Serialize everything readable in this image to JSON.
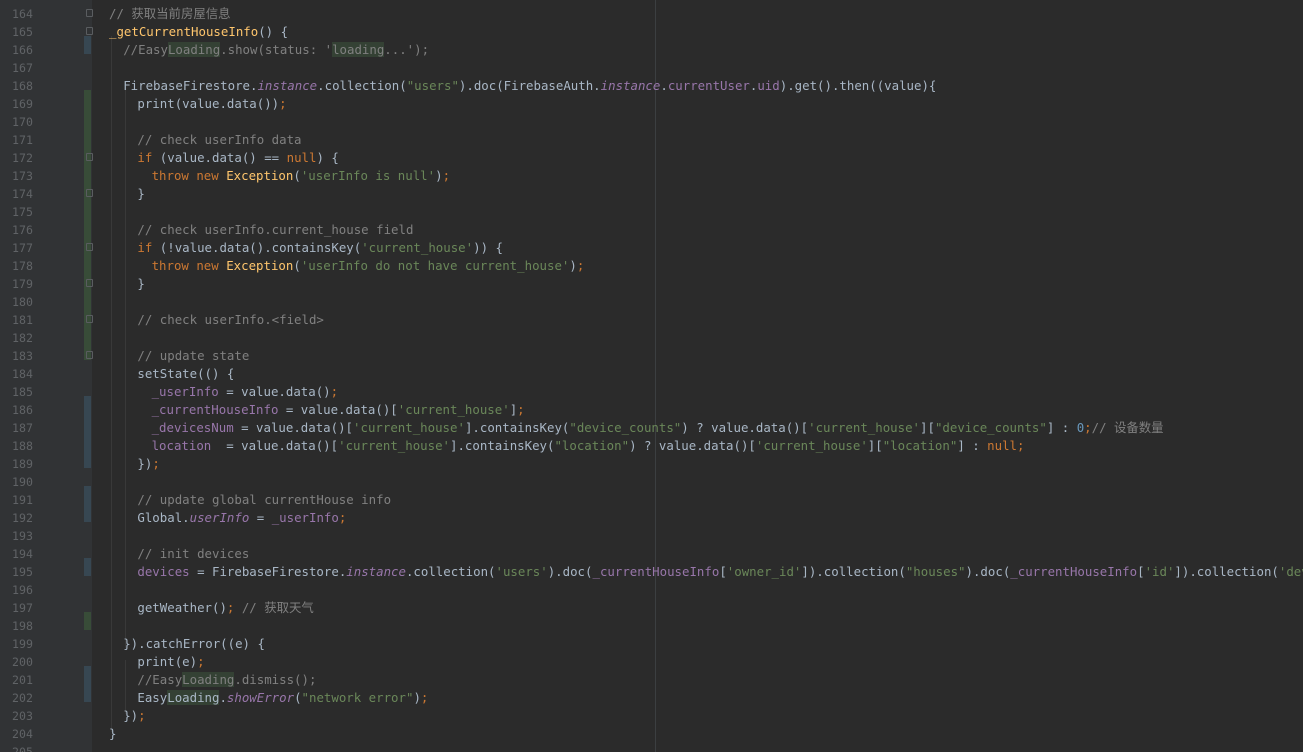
{
  "editor": {
    "lines": [
      {
        "no": "164",
        "tokens": [
          [
            "c",
            "// 获取当前房屋信息"
          ]
        ],
        "indent": 0,
        "fold": true
      },
      {
        "no": "165",
        "tokens": [
          [
            "f",
            "_getCurrentHouseInfo"
          ],
          [
            "",
            "() {"
          ]
        ],
        "indent": 0,
        "fold": true
      },
      {
        "no": "166",
        "tokens": [
          [
            "c",
            "//Easy"
          ],
          [
            "hlc",
            "Loading"
          ],
          [
            "c",
            ".show(status: '"
          ],
          [
            "hlc",
            "loading"
          ],
          [
            "c",
            "...');"
          ]
        ],
        "indent": 1
      },
      {
        "no": "167",
        "tokens": [],
        "indent": 1
      },
      {
        "no": "168",
        "tokens": [
          [
            "",
            "FirebaseFirestore."
          ],
          [
            "i",
            "instance"
          ],
          [
            "",
            ".collection("
          ],
          [
            "s",
            "\"users\""
          ],
          [
            "",
            ").doc(FirebaseAuth."
          ],
          [
            "i",
            "instance"
          ],
          [
            "",
            "."
          ],
          [
            "p",
            "currentUser"
          ],
          [
            "",
            "."
          ],
          [
            "p",
            "uid"
          ],
          [
            "",
            ").get().then((value){"
          ]
        ],
        "indent": 1
      },
      {
        "no": "169",
        "tokens": [
          [
            "",
            "print(value.data())"
          ],
          [
            "k",
            ";"
          ]
        ],
        "indent": 2
      },
      {
        "no": "170",
        "tokens": [],
        "indent": 2
      },
      {
        "no": "171",
        "tokens": [
          [
            "c",
            "// check userInfo data"
          ]
        ],
        "indent": 2
      },
      {
        "no": "172",
        "tokens": [
          [
            "k",
            "if "
          ],
          [
            "",
            "(value.data() == "
          ],
          [
            "k",
            "null"
          ],
          [
            "",
            ") {"
          ]
        ],
        "indent": 2,
        "fold": true
      },
      {
        "no": "173",
        "tokens": [
          [
            "k",
            "throw new "
          ],
          [
            "cls",
            "Exception"
          ],
          [
            "",
            "("
          ],
          [
            "s",
            "'userInfo is null'"
          ],
          [
            "",
            ")"
          ],
          [
            "k",
            ";"
          ]
        ],
        "indent": 3
      },
      {
        "no": "174",
        "tokens": [
          [
            "",
            "}"
          ]
        ],
        "indent": 2,
        "fold": true
      },
      {
        "no": "175",
        "tokens": [],
        "indent": 2
      },
      {
        "no": "176",
        "tokens": [
          [
            "c",
            "// check userInfo.current_house field"
          ]
        ],
        "indent": 2
      },
      {
        "no": "177",
        "tokens": [
          [
            "k",
            "if "
          ],
          [
            "",
            "(!value.data().containsKey("
          ],
          [
            "s",
            "'current_house'"
          ],
          [
            "",
            ")) {"
          ]
        ],
        "indent": 2,
        "fold": true
      },
      {
        "no": "178",
        "tokens": [
          [
            "k",
            "throw new "
          ],
          [
            "cls",
            "Exception"
          ],
          [
            "",
            "("
          ],
          [
            "s",
            "'userInfo do not have current_house'"
          ],
          [
            "",
            ")"
          ],
          [
            "k",
            ";"
          ]
        ],
        "indent": 3
      },
      {
        "no": "179",
        "tokens": [
          [
            "",
            "}"
          ]
        ],
        "indent": 2,
        "fold": true
      },
      {
        "no": "180",
        "tokens": [],
        "indent": 2
      },
      {
        "no": "181",
        "tokens": [
          [
            "c",
            "// check userInfo.<field>"
          ]
        ],
        "indent": 2,
        "fold": true
      },
      {
        "no": "182",
        "tokens": [],
        "indent": 2
      },
      {
        "no": "183",
        "tokens": [
          [
            "c",
            "// update state"
          ]
        ],
        "indent": 2,
        "fold": true
      },
      {
        "no": "184",
        "tokens": [
          [
            "",
            "setState(() {"
          ]
        ],
        "indent": 2
      },
      {
        "no": "185",
        "tokens": [
          [
            "p",
            "_userInfo "
          ],
          [
            "",
            "= value.data()"
          ],
          [
            "k",
            ";"
          ]
        ],
        "indent": 3
      },
      {
        "no": "186",
        "tokens": [
          [
            "p",
            "_currentHouseInfo "
          ],
          [
            "",
            "= value.data()["
          ],
          [
            "s",
            "'current_house'"
          ],
          [
            "",
            "]"
          ],
          [
            "k",
            ";"
          ]
        ],
        "indent": 3
      },
      {
        "no": "187",
        "tokens": [
          [
            "p",
            "_devicesNum "
          ],
          [
            "",
            "= value.data()["
          ],
          [
            "s",
            "'current_house'"
          ],
          [
            "",
            "].containsKey("
          ],
          [
            "s",
            "\"device_counts\""
          ],
          [
            "",
            ") ? value.data()["
          ],
          [
            "s",
            "'current_house'"
          ],
          [
            "",
            "]["
          ],
          [
            "s",
            "\"device_counts\""
          ],
          [
            "",
            "] : "
          ],
          [
            "n",
            "0"
          ],
          [
            "k",
            ";"
          ],
          [
            "c",
            "// 设备数量"
          ]
        ],
        "indent": 3
      },
      {
        "no": "188",
        "tokens": [
          [
            "p",
            "location  "
          ],
          [
            "",
            "= value.data()["
          ],
          [
            "s",
            "'current_house'"
          ],
          [
            "",
            "].containsKey("
          ],
          [
            "s",
            "\"location\""
          ],
          [
            "",
            ") ? value.data()["
          ],
          [
            "s",
            "'current_house'"
          ],
          [
            "",
            "]["
          ],
          [
            "s",
            "\"location\""
          ],
          [
            "",
            "] : "
          ],
          [
            "k",
            "null;"
          ]
        ],
        "indent": 3
      },
      {
        "no": "189",
        "tokens": [
          [
            "",
            "})"
          ],
          [
            "k",
            ";"
          ]
        ],
        "indent": 2
      },
      {
        "no": "190",
        "tokens": [],
        "indent": 2
      },
      {
        "no": "191",
        "tokens": [
          [
            "c",
            "// update global currentHouse info"
          ]
        ],
        "indent": 2
      },
      {
        "no": "192",
        "tokens": [
          [
            "",
            "Global."
          ],
          [
            "i",
            "userInfo"
          ],
          [
            "",
            " = "
          ],
          [
            "p",
            "_userInfo"
          ],
          [
            "k",
            ";"
          ]
        ],
        "indent": 2
      },
      {
        "no": "193",
        "tokens": [],
        "indent": 2
      },
      {
        "no": "194",
        "tokens": [
          [
            "c",
            "// init devices"
          ]
        ],
        "indent": 2
      },
      {
        "no": "195",
        "tokens": [
          [
            "p",
            "devices "
          ],
          [
            "",
            "= FirebaseFirestore."
          ],
          [
            "i",
            "instance"
          ],
          [
            "",
            ".collection("
          ],
          [
            "s",
            "'users'"
          ],
          [
            "",
            ").doc("
          ],
          [
            "p",
            "_currentHouseInfo"
          ],
          [
            "",
            "["
          ],
          [
            "s",
            "'owner_id'"
          ],
          [
            "",
            "]).collection("
          ],
          [
            "s",
            "\"houses\""
          ],
          [
            "",
            ").doc("
          ],
          [
            "p",
            "_currentHouseInfo"
          ],
          [
            "",
            "["
          ],
          [
            "s",
            "'id'"
          ],
          [
            "",
            "]).collection("
          ],
          [
            "s",
            "'devices'"
          ],
          [
            "",
            ")"
          ],
          [
            "k",
            ";"
          ]
        ],
        "indent": 2
      },
      {
        "no": "196",
        "tokens": [],
        "indent": 2
      },
      {
        "no": "197",
        "tokens": [
          [
            "",
            "getWeather()"
          ],
          [
            "k",
            "; "
          ],
          [
            "c",
            "// 获取天气"
          ]
        ],
        "indent": 2
      },
      {
        "no": "198",
        "tokens": [],
        "indent": 2
      },
      {
        "no": "199",
        "tokens": [
          [
            "",
            "}).catchError((e) {"
          ]
        ],
        "indent": 1
      },
      {
        "no": "200",
        "tokens": [
          [
            "",
            "print(e)"
          ],
          [
            "k",
            ";"
          ]
        ],
        "indent": 2
      },
      {
        "no": "201",
        "tokens": [
          [
            "c",
            "//Easy"
          ],
          [
            "hlc",
            "Loading"
          ],
          [
            "c",
            ".dismiss();"
          ]
        ],
        "indent": 2
      },
      {
        "no": "202",
        "tokens": [
          [
            "",
            "Easy"
          ],
          [
            "hl",
            "Loading"
          ],
          [
            "",
            "."
          ],
          [
            "i",
            "showError"
          ],
          [
            "",
            "("
          ],
          [
            "s",
            "\"network error\""
          ],
          [
            "",
            ")"
          ],
          [
            "k",
            ";"
          ]
        ],
        "indent": 2
      },
      {
        "no": "203",
        "tokens": [
          [
            "",
            "})"
          ],
          [
            "k",
            ";"
          ]
        ],
        "indent": 1
      },
      {
        "no": "204",
        "tokens": [
          [
            "",
            "}"
          ]
        ],
        "indent": 0
      },
      {
        "no": "205",
        "tokens": [],
        "indent": 0
      }
    ]
  }
}
